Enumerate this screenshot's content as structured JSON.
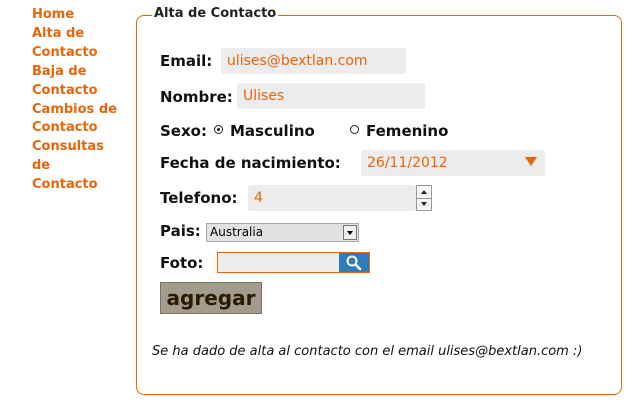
{
  "nav": [
    "Home",
    "Alta de",
    "Contacto",
    "Baja de",
    "Contacto",
    "Cambios de",
    "Contacto",
    "Consultas",
    "de",
    "Contacto"
  ],
  "form": {
    "legend": "Alta de Contacto",
    "email_label": "Email:",
    "email_value": "ulises@bextlan.com",
    "nombre_label": "Nombre:",
    "nombre_value": "Ulises",
    "sexo_label": "Sexo:",
    "sexo_options": [
      "Masculino",
      "Femenino"
    ],
    "fecha_label": "Fecha de nacimiento:",
    "fecha_value": "26/11/2012",
    "telefono_label": "Telefono:",
    "telefono_value": "4",
    "pais_label": "Pais:",
    "pais_value": "Australia",
    "foto_label": "Foto:",
    "submit_label": "agregar"
  },
  "message": "Se ha dado de alta al contacto con el email ulises@bextlan.com :)",
  "colors": {
    "accent": "#e8650a",
    "field_bg": "#ececec"
  },
  "icons": [
    "radio-checked-icon",
    "radio-unchecked-icon",
    "dropdown-arrow-icon",
    "spinner-up-icon",
    "spinner-down-icon",
    "select-arrow-icon",
    "search-icon"
  ]
}
